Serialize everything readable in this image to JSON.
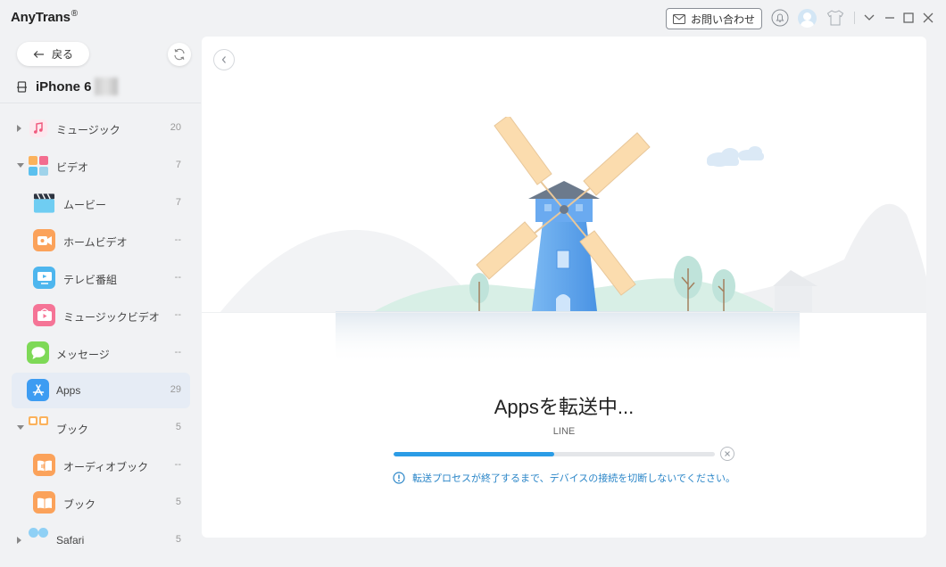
{
  "app": {
    "name": "AnyTrans",
    "mark": "®"
  },
  "header": {
    "contact_label": "お問い合わせ"
  },
  "sidebar": {
    "back_label": "戻る",
    "device_name": "iPhone 6",
    "items": [
      {
        "label": "ミュージック",
        "count": "20"
      },
      {
        "label": "ビデオ",
        "count": "7"
      },
      {
        "label": "ムービー",
        "count": "7"
      },
      {
        "label": "ホームビデオ",
        "count": "--"
      },
      {
        "label": "テレビ番組",
        "count": "--"
      },
      {
        "label": "ミュージックビデオ",
        "count": "--"
      },
      {
        "label": "メッセージ",
        "count": "--"
      },
      {
        "label": "Apps",
        "count": "29"
      },
      {
        "label": "ブック",
        "count": "5"
      },
      {
        "label": "オーディオブック",
        "count": "--"
      },
      {
        "label": "ブック",
        "count": "5"
      },
      {
        "label": "Safari",
        "count": "5"
      }
    ]
  },
  "transfer": {
    "title": "Appsを転送中...",
    "current_item": "LINE",
    "progress": 0.5,
    "notice": "転送プロセスが終了するまで、デバイスの接続を切断しないでください。"
  },
  "colors": {
    "accent": "#2b9ce6",
    "active_row": "#e6ecf5",
    "notice": "#2b86c8"
  }
}
